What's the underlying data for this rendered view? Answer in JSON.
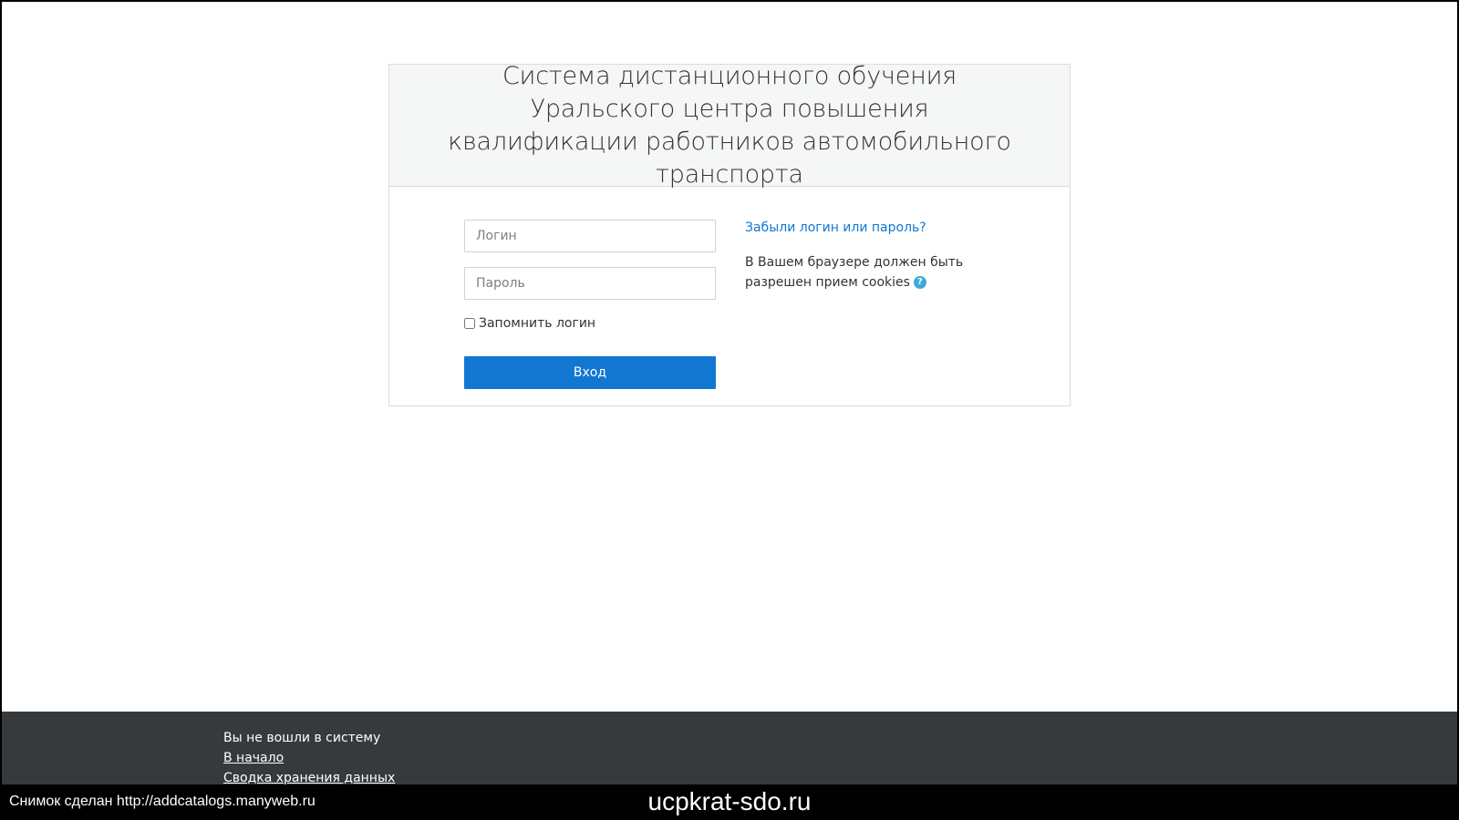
{
  "login": {
    "title": "Система дистанционного обучения Уральского центра повышения квалификации работников автомобильного транспорта",
    "username_placeholder": "Логин",
    "password_placeholder": "Пароль",
    "remember_label": "Запомнить логин",
    "submit_label": "Вход",
    "forgot_link": "Забыли логин или пароль?",
    "cookies_note": "В Вашем браузере должен быть разрешен прием cookies",
    "help_icon": "question-circle-icon"
  },
  "footer": {
    "status": "Вы не вошли в систему",
    "home_link": "В начало",
    "data_retention_link": "Сводка хранения данных"
  },
  "overlay": {
    "snapshot_text": "Снимок сделан http://addcatalogs.manyweb.ru",
    "domain": "ucpkrat-sdo.ru"
  },
  "colors": {
    "primary": "#1177d1",
    "footer_bg": "#373a3c",
    "header_bg": "#f5f6f6"
  }
}
